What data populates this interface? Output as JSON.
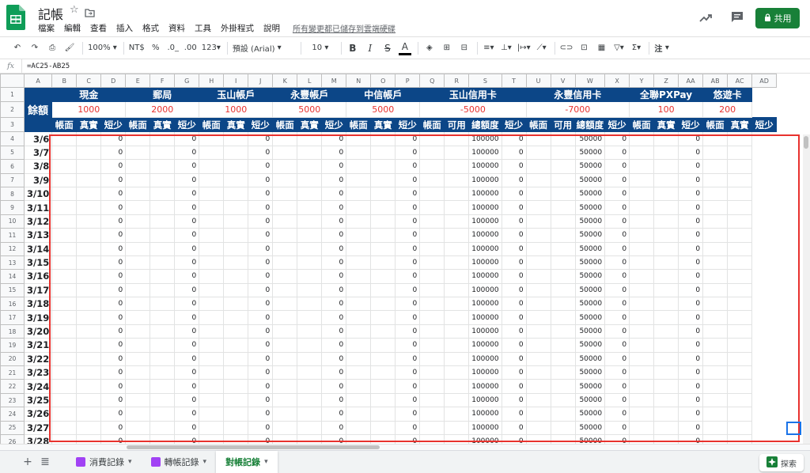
{
  "title": "記帳",
  "menu": [
    "檔案",
    "編輯",
    "查看",
    "插入",
    "格式",
    "資料",
    "工具",
    "外掛程式",
    "說明"
  ],
  "save_status": "所有變更都已儲存到雲端硬碟",
  "share_label": "共用",
  "toolbar": {
    "zoom": "100%",
    "currency": "NT$",
    "percent": "%",
    "dec_less": ".0_",
    "dec_more": ".00",
    "more_formats": "123",
    "font": "預設 (Arial)",
    "font_size": "10",
    "bold": "B",
    "italic": "I",
    "strike": "S",
    "text_color": "A",
    "sigma": "Σ",
    "input_tools": "注"
  },
  "formula": {
    "fx": "fx",
    "text": "=AC25-AB25"
  },
  "columns": [
    "A",
    "B",
    "C",
    "D",
    "E",
    "F",
    "G",
    "H",
    "I",
    "J",
    "K",
    "L",
    "M",
    "N",
    "O",
    "P",
    "Q",
    "R",
    "S",
    "T",
    "U",
    "V",
    "W",
    "X",
    "Y",
    "Z",
    "AA",
    "AB",
    "AC",
    "AD"
  ],
  "row1_groups": [
    {
      "label": "現金",
      "span": 3
    },
    {
      "label": "郵局",
      "span": 3
    },
    {
      "label": "玉山帳戶",
      "span": 3
    },
    {
      "label": "永豐帳戶",
      "span": 3
    },
    {
      "label": "中信帳戶",
      "span": 3
    },
    {
      "label": "玉山信用卡",
      "span": 4
    },
    {
      "label": "永豐信用卡",
      "span": 4
    },
    {
      "label": "全聯PXPay",
      "span": 3
    },
    {
      "label": "悠遊卡",
      "span": 2
    }
  ],
  "balance_label": "餘額",
  "balances": [
    {
      "value": "1000",
      "span": 3
    },
    {
      "value": "2000",
      "span": 3
    },
    {
      "value": "1000",
      "span": 3
    },
    {
      "value": "5000",
      "span": 3
    },
    {
      "value": "5000",
      "span": 3
    },
    {
      "value": "-5000",
      "span": 4
    },
    {
      "value": "-7000",
      "span": 4
    },
    {
      "value": "100",
      "span": 3
    },
    {
      "value": "200",
      "span": 2
    }
  ],
  "subheaders": [
    "帳面",
    "真實",
    "短少",
    "帳面",
    "真實",
    "短少",
    "帳面",
    "真實",
    "短少",
    "帳面",
    "真實",
    "短少",
    "帳面",
    "真實",
    "短少",
    "帳面",
    "可用",
    "總額度",
    "短少",
    "帳面",
    "可用",
    "總額度",
    "短少",
    "帳面",
    "真實",
    "短少",
    "帳面",
    "真實",
    "短少"
  ],
  "dates": [
    "3/6",
    "3/7",
    "3/8",
    "3/9",
    "3/10",
    "3/11",
    "3/12",
    "3/13",
    "3/14",
    "3/15",
    "3/16",
    "3/17",
    "3/18",
    "3/19",
    "3/20",
    "3/21",
    "3/22",
    "3/23",
    "3/24",
    "3/25",
    "3/26",
    "3/27",
    "3/28"
  ],
  "first_data_row": 4,
  "cell_values": {
    "zero": "0",
    "esun_limit": "100000",
    "sinopac_limit": "50000"
  },
  "sheets": [
    {
      "label": "消費記錄",
      "active": false
    },
    {
      "label": "轉帳記錄",
      "active": false
    },
    {
      "label": "對帳記錄",
      "active": true
    }
  ],
  "explore_label": "探索",
  "colors": {
    "header_blue": "#0c4687",
    "balance_red": "#e8322e",
    "share_green": "#188038",
    "selection_red": "#e8322e"
  }
}
